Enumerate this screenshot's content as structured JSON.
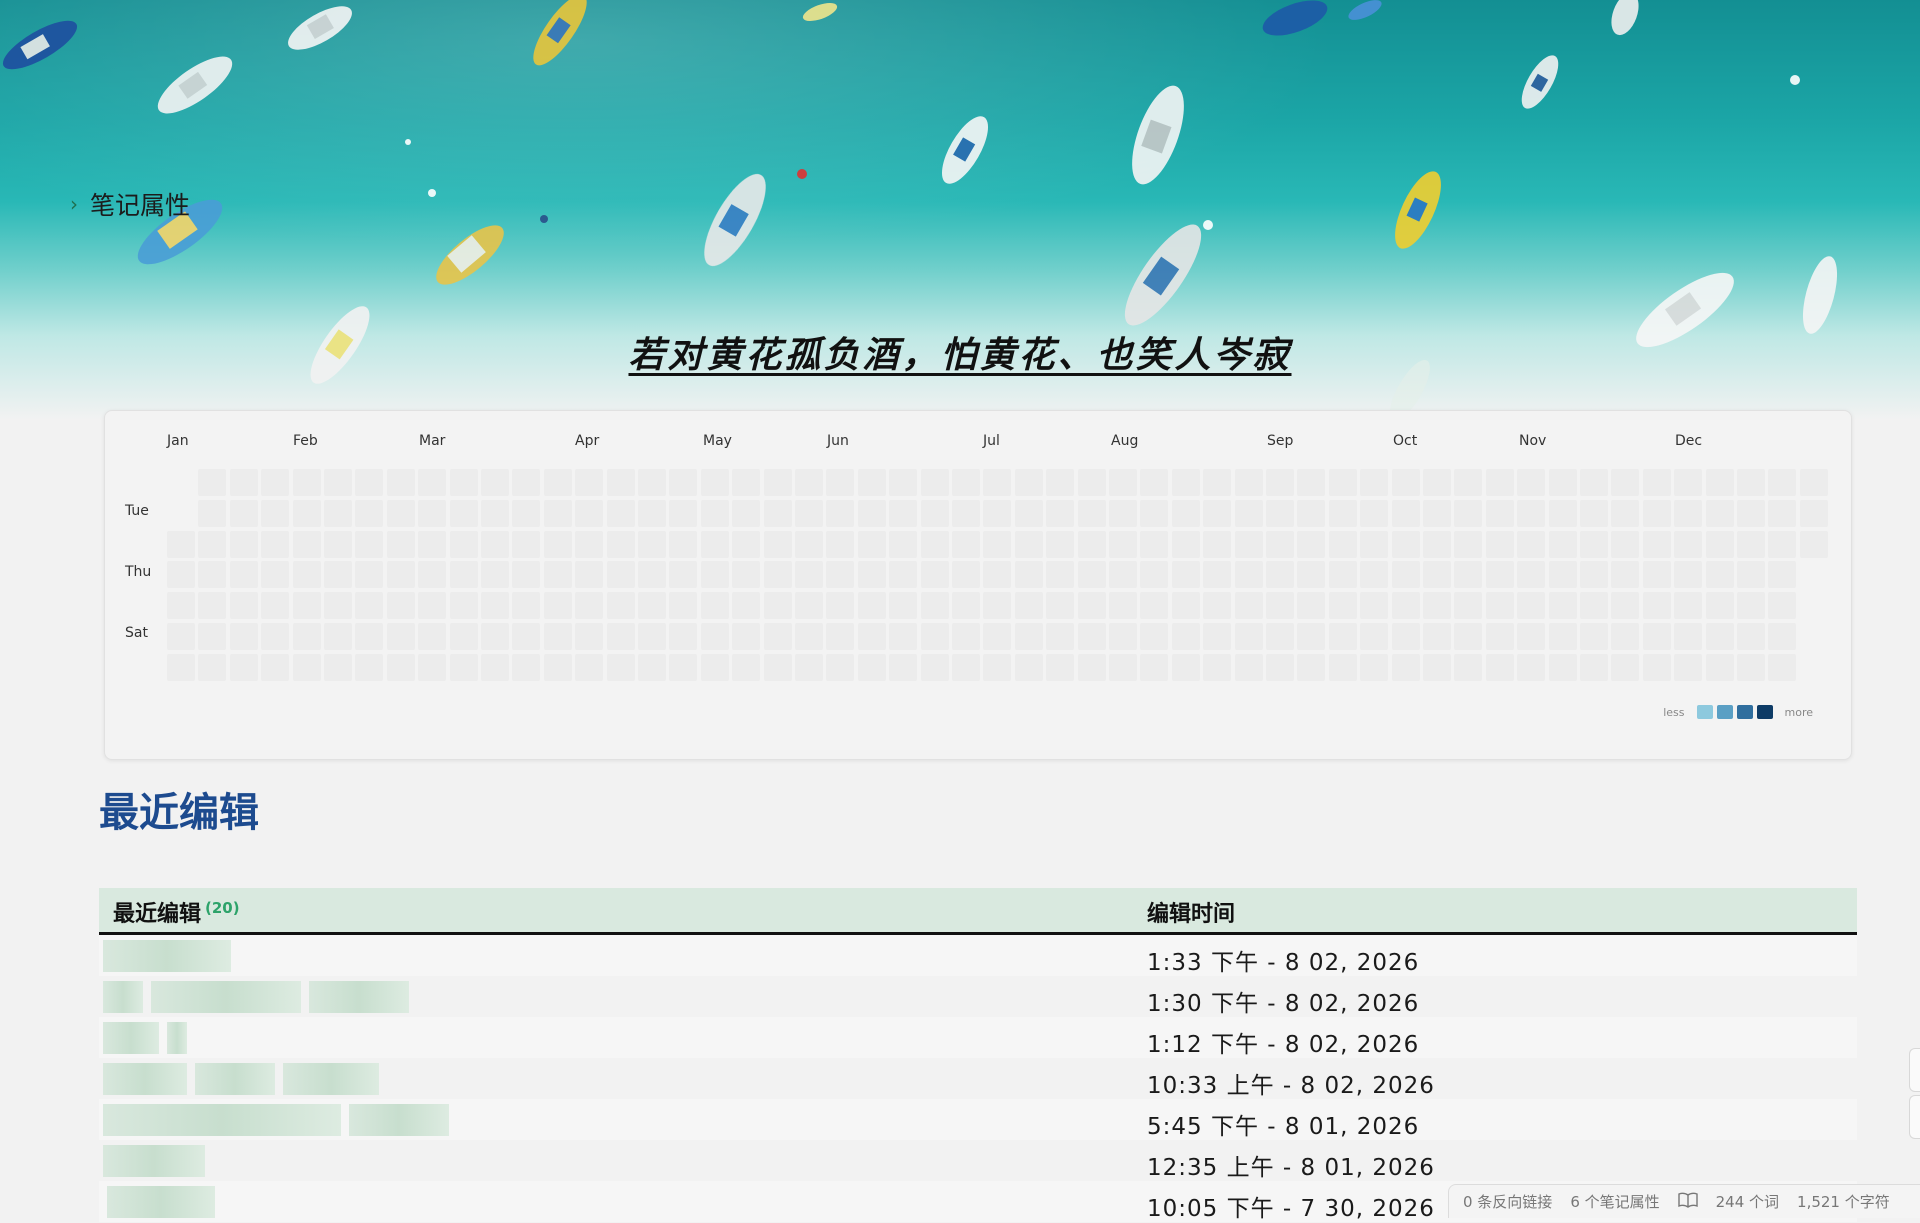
{
  "banner": {
    "properties_label": "笔记属性",
    "quote": "若对黄花孤负酒，怕黄花、也笑人岑寂"
  },
  "heatmap": {
    "months": [
      "Jan",
      "Feb",
      "Mar",
      "Apr",
      "May",
      "Jun",
      "Jul",
      "Aug",
      "Sep",
      "Oct",
      "Nov",
      "Dec"
    ],
    "day_labels": [
      "Tue",
      "Thu",
      "Sat"
    ],
    "legend_less": "less",
    "legend_more": "more",
    "legend_colors": [
      "#8dc9de",
      "#5a9fc4",
      "#2f6e9e",
      "#0d3b66"
    ],
    "empty_cell_color": "#ececec"
  },
  "recent": {
    "title": "最近编辑",
    "col_name": "最近编辑",
    "col_count": "(20)",
    "col_time": "编辑时间",
    "rows": [
      {
        "time": "1:33 下午 - 8 02, 2026"
      },
      {
        "time": "1:30 下午 - 8 02, 2026"
      },
      {
        "time": "1:12 下午 - 8 02, 2026"
      },
      {
        "time": "10:33 上午 - 8 02, 2026"
      },
      {
        "time": "5:45 下午 - 8 01, 2026"
      },
      {
        "time": "12:35 上午 - 8 01, 2026"
      },
      {
        "time": "10:05 下午 - 7 30, 2026"
      }
    ]
  },
  "status": {
    "backlinks": "0 条反向链接",
    "properties": "6 个笔记属性",
    "book_icon": "book-icon",
    "words": "244 个词",
    "chars": "1,521 个字符"
  }
}
